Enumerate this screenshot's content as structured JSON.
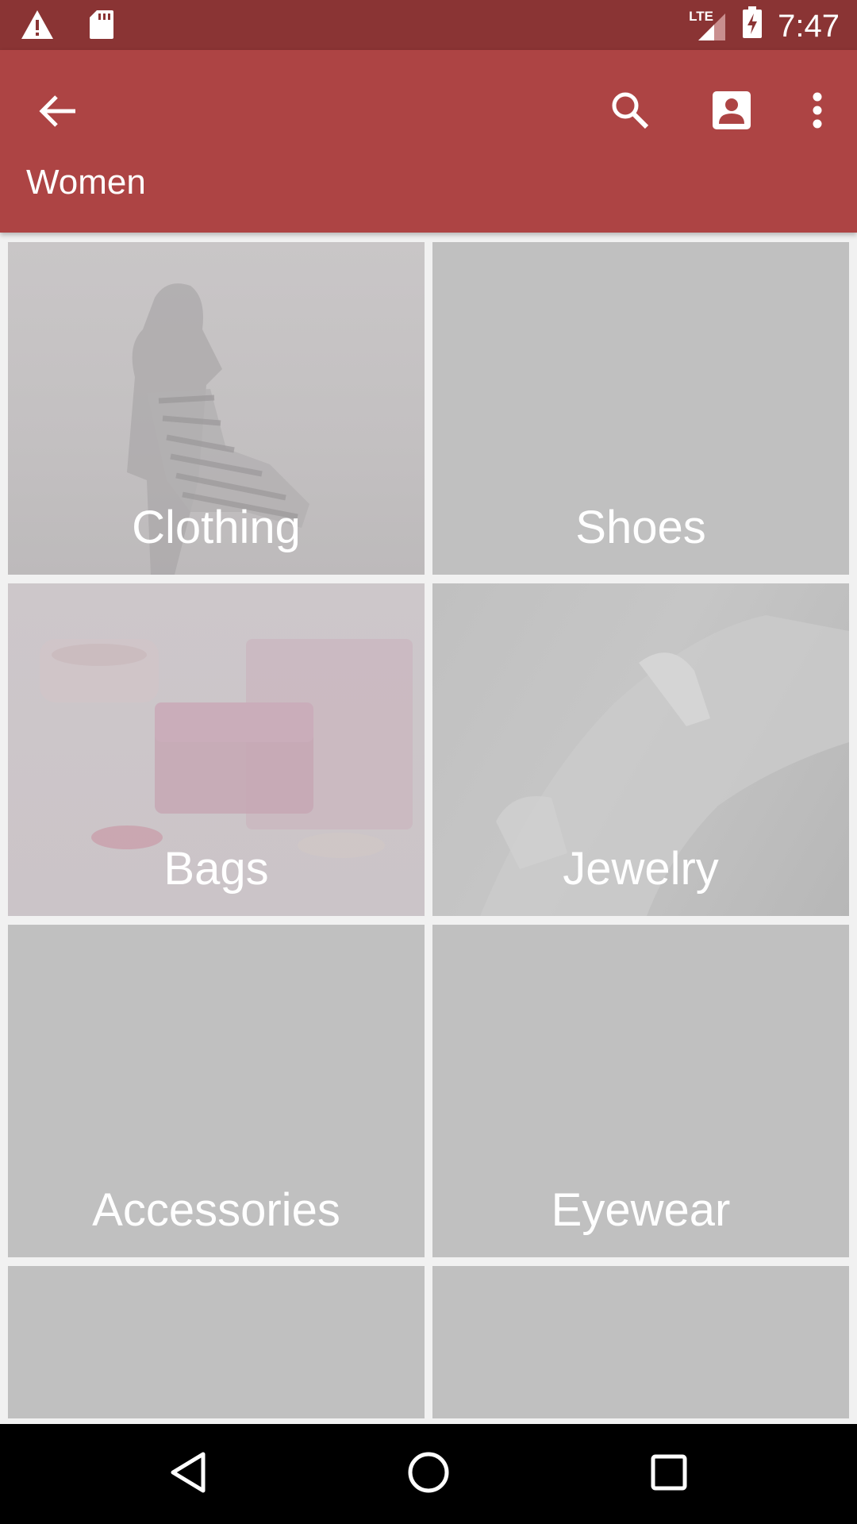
{
  "status_bar": {
    "time": "7:47",
    "network": "LTE",
    "icons": [
      "warning-icon",
      "sd-card-icon",
      "signal-icon",
      "battery-charging-icon"
    ]
  },
  "toolbar": {
    "title": "Women",
    "icons": [
      "back-arrow-icon",
      "search-icon",
      "account-box-icon",
      "more-vert-icon"
    ]
  },
  "categories": [
    {
      "label": "Clothing"
    },
    {
      "label": "Shoes"
    },
    {
      "label": "Bags"
    },
    {
      "label": "Jewelry"
    },
    {
      "label": "Accessories"
    },
    {
      "label": "Eyewear"
    },
    {
      "label": ""
    },
    {
      "label": ""
    }
  ],
  "colors": {
    "status_bar": "#8a3434",
    "toolbar": "#ad4444",
    "tile_placeholder": "#c0c0c0"
  }
}
